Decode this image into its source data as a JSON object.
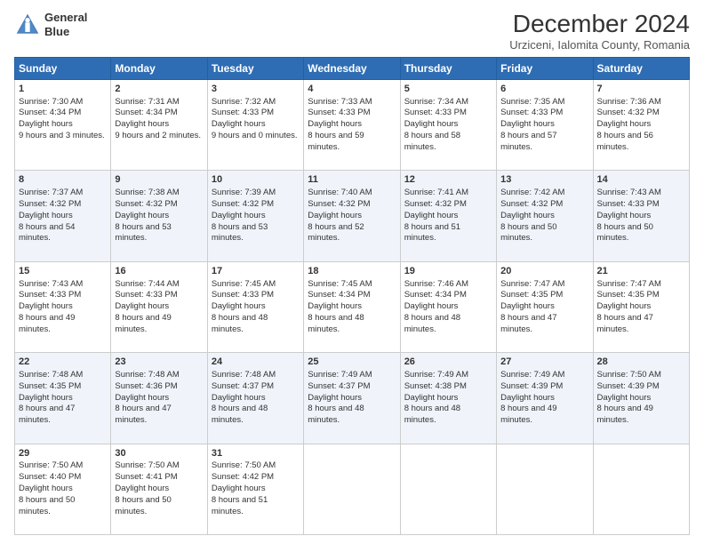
{
  "header": {
    "logo_line1": "General",
    "logo_line2": "Blue",
    "month": "December 2024",
    "location": "Urziceni, Ialomita County, Romania"
  },
  "weekdays": [
    "Sunday",
    "Monday",
    "Tuesday",
    "Wednesday",
    "Thursday",
    "Friday",
    "Saturday"
  ],
  "weeks": [
    [
      {
        "day": 1,
        "sunrise": "7:30 AM",
        "sunset": "4:34 PM",
        "daylight": "9 hours and 3 minutes."
      },
      {
        "day": 2,
        "sunrise": "7:31 AM",
        "sunset": "4:34 PM",
        "daylight": "9 hours and 2 minutes."
      },
      {
        "day": 3,
        "sunrise": "7:32 AM",
        "sunset": "4:33 PM",
        "daylight": "9 hours and 0 minutes."
      },
      {
        "day": 4,
        "sunrise": "7:33 AM",
        "sunset": "4:33 PM",
        "daylight": "8 hours and 59 minutes."
      },
      {
        "day": 5,
        "sunrise": "7:34 AM",
        "sunset": "4:33 PM",
        "daylight": "8 hours and 58 minutes."
      },
      {
        "day": 6,
        "sunrise": "7:35 AM",
        "sunset": "4:33 PM",
        "daylight": "8 hours and 57 minutes."
      },
      {
        "day": 7,
        "sunrise": "7:36 AM",
        "sunset": "4:32 PM",
        "daylight": "8 hours and 56 minutes."
      }
    ],
    [
      {
        "day": 8,
        "sunrise": "7:37 AM",
        "sunset": "4:32 PM",
        "daylight": "8 hours and 54 minutes."
      },
      {
        "day": 9,
        "sunrise": "7:38 AM",
        "sunset": "4:32 PM",
        "daylight": "8 hours and 53 minutes."
      },
      {
        "day": 10,
        "sunrise": "7:39 AM",
        "sunset": "4:32 PM",
        "daylight": "8 hours and 53 minutes."
      },
      {
        "day": 11,
        "sunrise": "7:40 AM",
        "sunset": "4:32 PM",
        "daylight": "8 hours and 52 minutes."
      },
      {
        "day": 12,
        "sunrise": "7:41 AM",
        "sunset": "4:32 PM",
        "daylight": "8 hours and 51 minutes."
      },
      {
        "day": 13,
        "sunrise": "7:42 AM",
        "sunset": "4:32 PM",
        "daylight": "8 hours and 50 minutes."
      },
      {
        "day": 14,
        "sunrise": "7:43 AM",
        "sunset": "4:33 PM",
        "daylight": "8 hours and 50 minutes."
      }
    ],
    [
      {
        "day": 15,
        "sunrise": "7:43 AM",
        "sunset": "4:33 PM",
        "daylight": "8 hours and 49 minutes."
      },
      {
        "day": 16,
        "sunrise": "7:44 AM",
        "sunset": "4:33 PM",
        "daylight": "8 hours and 49 minutes."
      },
      {
        "day": 17,
        "sunrise": "7:45 AM",
        "sunset": "4:33 PM",
        "daylight": "8 hours and 48 minutes."
      },
      {
        "day": 18,
        "sunrise": "7:45 AM",
        "sunset": "4:34 PM",
        "daylight": "8 hours and 48 minutes."
      },
      {
        "day": 19,
        "sunrise": "7:46 AM",
        "sunset": "4:34 PM",
        "daylight": "8 hours and 48 minutes."
      },
      {
        "day": 20,
        "sunrise": "7:47 AM",
        "sunset": "4:35 PM",
        "daylight": "8 hours and 47 minutes."
      },
      {
        "day": 21,
        "sunrise": "7:47 AM",
        "sunset": "4:35 PM",
        "daylight": "8 hours and 47 minutes."
      }
    ],
    [
      {
        "day": 22,
        "sunrise": "7:48 AM",
        "sunset": "4:35 PM",
        "daylight": "8 hours and 47 minutes."
      },
      {
        "day": 23,
        "sunrise": "7:48 AM",
        "sunset": "4:36 PM",
        "daylight": "8 hours and 47 minutes."
      },
      {
        "day": 24,
        "sunrise": "7:48 AM",
        "sunset": "4:37 PM",
        "daylight": "8 hours and 48 minutes."
      },
      {
        "day": 25,
        "sunrise": "7:49 AM",
        "sunset": "4:37 PM",
        "daylight": "8 hours and 48 minutes."
      },
      {
        "day": 26,
        "sunrise": "7:49 AM",
        "sunset": "4:38 PM",
        "daylight": "8 hours and 48 minutes."
      },
      {
        "day": 27,
        "sunrise": "7:49 AM",
        "sunset": "4:39 PM",
        "daylight": "8 hours and 49 minutes."
      },
      {
        "day": 28,
        "sunrise": "7:50 AM",
        "sunset": "4:39 PM",
        "daylight": "8 hours and 49 minutes."
      }
    ],
    [
      {
        "day": 29,
        "sunrise": "7:50 AM",
        "sunset": "4:40 PM",
        "daylight": "8 hours and 50 minutes."
      },
      {
        "day": 30,
        "sunrise": "7:50 AM",
        "sunset": "4:41 PM",
        "daylight": "8 hours and 50 minutes."
      },
      {
        "day": 31,
        "sunrise": "7:50 AM",
        "sunset": "4:42 PM",
        "daylight": "8 hours and 51 minutes."
      },
      null,
      null,
      null,
      null
    ]
  ]
}
